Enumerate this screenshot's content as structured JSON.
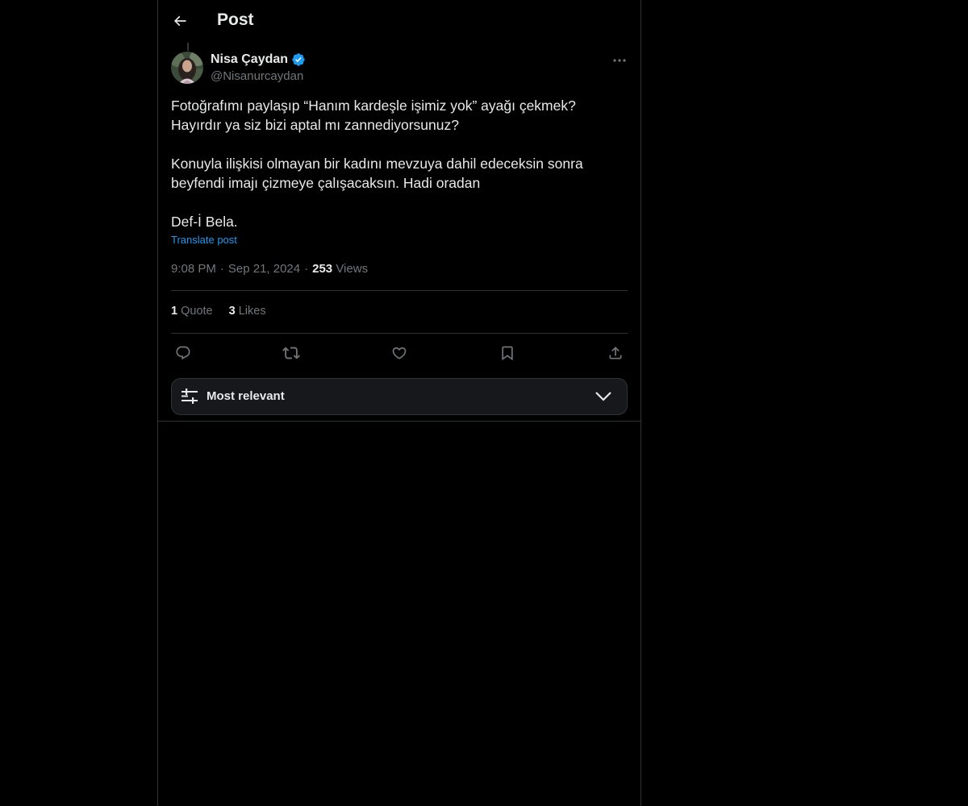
{
  "header": {
    "title": "Post"
  },
  "author": {
    "name": "Nisa Çaydan",
    "handle": "@Nisanurcaydan",
    "verified_color": "#1d9bf0"
  },
  "post": {
    "paragraphs": [
      [
        "Fotoğrafımı paylaşıp “Hanım kardeşle işimiz yok” ayağı çekmek?",
        "Hayırdır ya siz bizi aptal mı zannediyorsunuz?"
      ],
      [
        "Konuyla ilişkisi olmayan bir kadını mevzuya dahil edeceksin sonra",
        "beyfendi imajı çizmeye çalışacaksın. Hadi oradan"
      ],
      [
        "Def-İ Bela."
      ]
    ],
    "translate_label": "Translate post",
    "time": "9:08 PM",
    "date": "Sep 21, 2024",
    "views_count": "253",
    "views_label": "Views",
    "separator": "·"
  },
  "stats": {
    "quotes_count": "1",
    "quotes_label": "Quote",
    "likes_count": "3",
    "likes_label": "Likes"
  },
  "actions": [
    "reply-icon",
    "repost-icon",
    "like-icon",
    "bookmark-icon",
    "share-icon"
  ],
  "sort": {
    "label": "Most relevant"
  },
  "colors": {
    "background": "#000000",
    "text_primary": "#e7e9ea",
    "text_secondary": "#71767b",
    "accent": "#1d9bf0",
    "border": "#2f3336"
  }
}
